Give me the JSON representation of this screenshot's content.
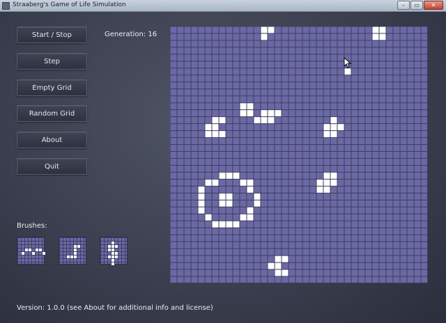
{
  "window": {
    "title": "Straaberg's Game of Life Simulation",
    "controls": [
      "–",
      "▭",
      "✕"
    ]
  },
  "buttons": [
    {
      "id": "start-stop",
      "label": "Start / Stop"
    },
    {
      "id": "step",
      "label": "Step"
    },
    {
      "id": "empty-grid",
      "label": "Empty Grid"
    },
    {
      "id": "random-grid",
      "label": "Random Grid"
    },
    {
      "id": "about",
      "label": "About"
    },
    {
      "id": "quit",
      "label": "Quit"
    }
  ],
  "generation_text": "Generation: 16",
  "brushes_label": "Brushes:",
  "version_text": "Version: 1.0.0 (see About for additional info and license)",
  "colors": {
    "grid_cell": "#6a69a4",
    "grid_line": "#3d3d62",
    "live_cell": "#ffffff"
  },
  "grid": {
    "columns": 37,
    "rows": 37,
    "live_cells": [
      [
        13,
        0
      ],
      [
        14,
        0
      ],
      [
        13,
        1
      ],
      [
        29,
        0
      ],
      [
        30,
        0
      ],
      [
        29,
        1
      ],
      [
        30,
        1
      ],
      [
        25,
        6
      ],
      [
        10,
        11
      ],
      [
        11,
        11
      ],
      [
        10,
        12
      ],
      [
        11,
        12
      ],
      [
        13,
        12
      ],
      [
        14,
        12
      ],
      [
        15,
        12
      ],
      [
        12,
        13
      ],
      [
        13,
        13
      ],
      [
        14,
        13
      ],
      [
        6,
        13
      ],
      [
        7,
        13
      ],
      [
        5,
        14
      ],
      [
        6,
        14
      ],
      [
        5,
        15
      ],
      [
        6,
        15
      ],
      [
        7,
        15
      ],
      [
        23,
        13
      ],
      [
        22,
        14
      ],
      [
        23,
        14
      ],
      [
        24,
        14
      ],
      [
        22,
        15
      ],
      [
        23,
        15
      ],
      [
        7,
        21
      ],
      [
        8,
        21
      ],
      [
        9,
        21
      ],
      [
        5,
        22
      ],
      [
        6,
        22
      ],
      [
        10,
        22
      ],
      [
        11,
        22
      ],
      [
        4,
        23
      ],
      [
        11,
        23
      ],
      [
        4,
        24
      ],
      [
        7,
        24
      ],
      [
        8,
        24
      ],
      [
        12,
        24
      ],
      [
        4,
        25
      ],
      [
        7,
        25
      ],
      [
        8,
        25
      ],
      [
        12,
        25
      ],
      [
        4,
        26
      ],
      [
        11,
        26
      ],
      [
        5,
        27
      ],
      [
        10,
        27
      ],
      [
        11,
        27
      ],
      [
        6,
        28
      ],
      [
        7,
        28
      ],
      [
        8,
        28
      ],
      [
        9,
        28
      ],
      [
        22,
        21
      ],
      [
        23,
        21
      ],
      [
        21,
        22
      ],
      [
        22,
        22
      ],
      [
        23,
        22
      ],
      [
        21,
        23
      ],
      [
        22,
        23
      ],
      [
        15,
        33
      ],
      [
        16,
        33
      ],
      [
        14,
        34
      ],
      [
        15,
        34
      ],
      [
        15,
        35
      ],
      [
        16,
        35
      ]
    ]
  },
  "brushes": [
    {
      "name": "glider-gun-line",
      "cells": [
        [
          1,
          4
        ],
        [
          2,
          3
        ],
        [
          3,
          3
        ],
        [
          4,
          4
        ],
        [
          5,
          3
        ],
        [
          6,
          3
        ],
        [
          7,
          4
        ]
      ]
    },
    {
      "name": "small-l",
      "cells": [
        [
          4,
          2
        ],
        [
          4,
          3
        ],
        [
          4,
          4
        ],
        [
          4,
          5
        ],
        [
          3,
          5
        ],
        [
          2,
          5
        ],
        [
          5,
          2
        ]
      ]
    },
    {
      "name": "dollar",
      "cells": [
        [
          3,
          1
        ],
        [
          3,
          2
        ],
        [
          3,
          3
        ],
        [
          3,
          4
        ],
        [
          3,
          5
        ],
        [
          3,
          6
        ],
        [
          2,
          2
        ],
        [
          4,
          2
        ],
        [
          2,
          3
        ],
        [
          4,
          4
        ],
        [
          2,
          5
        ],
        [
          4,
          5
        ],
        [
          3,
          7
        ]
      ]
    }
  ]
}
